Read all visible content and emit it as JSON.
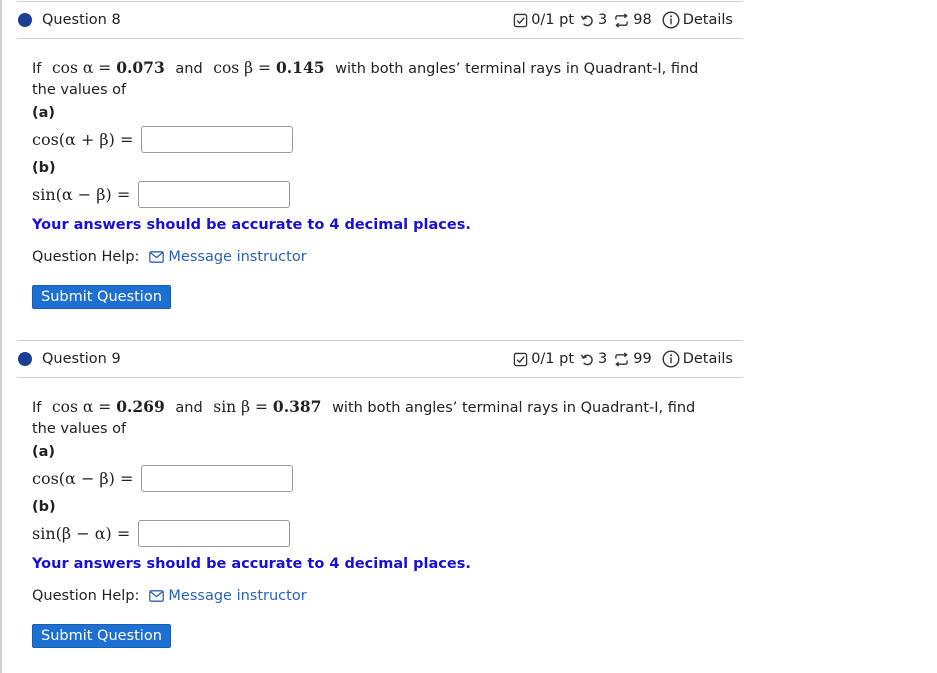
{
  "questions": [
    {
      "title": "Question 8",
      "score": "0/1 pt",
      "attempts": "3",
      "versions": "98",
      "details_label": "Details",
      "prompt_if": "If",
      "given1_label": "cos α =",
      "given1_value": "0.073",
      "and_label": "and",
      "given2_label": "cos β =",
      "given2_value": "0.145",
      "prompt_rest": "with both angles’ terminal rays in Quadrant-I, find the values of",
      "part_a_label": "(a)",
      "part_a_expr": "cos(α + β) =",
      "part_a_value": "",
      "part_b_label": "(b)",
      "part_b_expr": "sin(α − β) =",
      "part_b_value": "",
      "accuracy_note": "Your answers should be accurate to 4 decimal places.",
      "help_label": "Question Help:",
      "message_link": "Message instructor",
      "submit_label": "Submit Question"
    },
    {
      "title": "Question 9",
      "score": "0/1 pt",
      "attempts": "3",
      "versions": "99",
      "details_label": "Details",
      "prompt_if": "If",
      "given1_label": "cos α =",
      "given1_value": "0.269",
      "and_label": "and",
      "given2_label": "sin β =",
      "given2_value": "0.387",
      "prompt_rest": "with both angles’ terminal rays in Quadrant-I, find the values of",
      "part_a_label": "(a)",
      "part_a_expr": "cos(α − β) =",
      "part_a_value": "",
      "part_b_label": "(b)",
      "part_b_expr": "sin(β − α) =",
      "part_b_value": "",
      "accuracy_note": "Your answers should be accurate to 4 decimal places.",
      "help_label": "Question Help:",
      "message_link": "Message instructor",
      "submit_label": "Submit Question"
    }
  ],
  "colors": {
    "bullet": "#1c3f95",
    "accuracy_text": "#1a0fd6",
    "link": "#2a62b8",
    "submit_bg": "#1d6fd1"
  },
  "icons": {
    "score": "score-check-icon",
    "attempts": "retry-icon",
    "versions": "versions-icon",
    "details": "info-icon",
    "message": "mail-icon"
  }
}
